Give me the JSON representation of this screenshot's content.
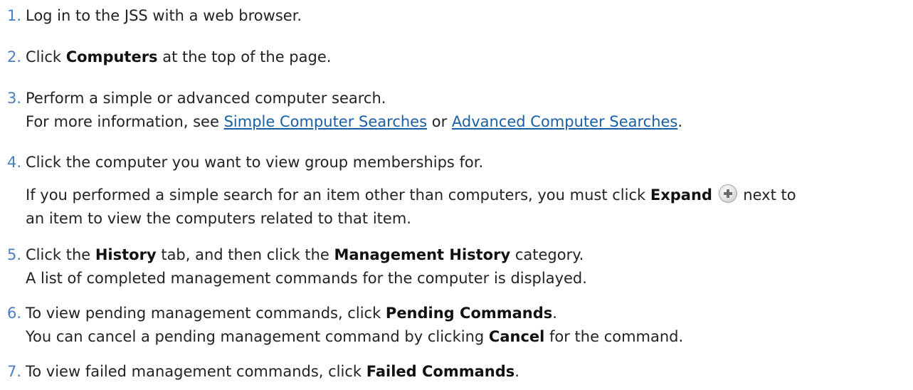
{
  "steps": [
    {
      "num": "1.",
      "text": "Log in to the JSS with a web browser."
    },
    {
      "num": "2.",
      "pre": "Click ",
      "bold": "Computers",
      "post": " at the top of the page."
    },
    {
      "num": "3.",
      "text": "Perform a simple or advanced computer search.",
      "line2_pre": "For more information, see ",
      "link1": "Simple Computer Searches",
      "line2_mid": " or ",
      "link2": "Advanced Computer Searches",
      "line2_post": "."
    },
    {
      "num": "4.",
      "text": "Click the computer you want to view group memberships for.",
      "para_pre": "If you performed a simple search for an item other than computers, you must click ",
      "para_bold": "Expand",
      "para_post_1": " next to",
      "para_line2": "an item to view the computers related to that item.",
      "icon": "expand-plus-icon"
    },
    {
      "num": "5.",
      "pre": "Click the ",
      "bold1": "History",
      "mid": " tab, and then click the ",
      "bold2": "Management History",
      "post": " category.",
      "line2": "A list of completed management commands for the computer is displayed."
    },
    {
      "num": "6.",
      "pre": "To view pending management commands, click ",
      "bold": "Pending Commands",
      "post": ".",
      "line2_pre": "You can cancel a pending management command by clicking ",
      "line2_bold": "Cancel",
      "line2_post": " for the command."
    },
    {
      "num": "7.",
      "pre": "To view failed management commands, click ",
      "bold": "Failed Commands",
      "post": "."
    }
  ],
  "colors": {
    "number": "#4a7fbf",
    "link": "#1a5fa3",
    "text": "#222222"
  }
}
